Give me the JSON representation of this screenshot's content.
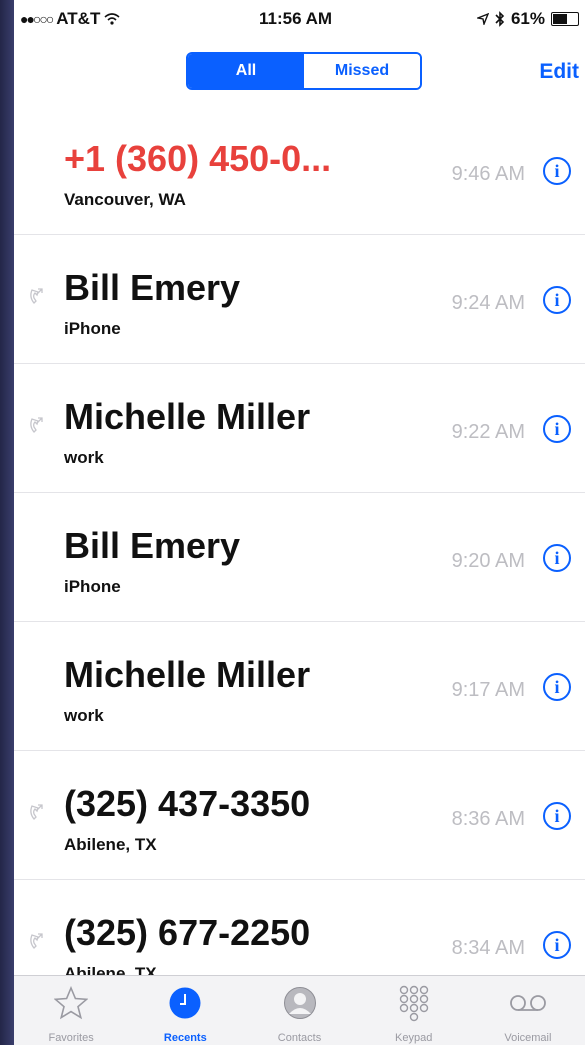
{
  "status_bar": {
    "signal": "●●○○○",
    "carrier": "AT&T",
    "time": "11:56 AM",
    "battery": "61%",
    "battery_level": 0.61
  },
  "nav": {
    "segments": [
      "All",
      "Missed"
    ],
    "selected_segment": "All",
    "edit_label": "Edit"
  },
  "calls": [
    {
      "name": "+1 (360) 450-0...",
      "detail": "Vancouver, WA",
      "time": "9:46 AM",
      "missed": true,
      "outgoing": false
    },
    {
      "name": "Bill Emery",
      "detail": "iPhone",
      "time": "9:24 AM",
      "missed": false,
      "outgoing": true
    },
    {
      "name": "Michelle Miller",
      "detail": "work",
      "time": "9:22 AM",
      "missed": false,
      "outgoing": true
    },
    {
      "name": "Bill Emery",
      "detail": "iPhone",
      "time": "9:20 AM",
      "missed": false,
      "outgoing": false
    },
    {
      "name": "Michelle Miller",
      "detail": "work",
      "time": "9:17 AM",
      "missed": false,
      "outgoing": false
    },
    {
      "name": "(325) 437-3350",
      "detail": "Abilene, TX",
      "time": "8:36 AM",
      "missed": false,
      "outgoing": true
    },
    {
      "name": "(325) 677-2250",
      "detail": "Abilene, TX",
      "time": "8:34 AM",
      "missed": false,
      "outgoing": true
    }
  ],
  "tabs": [
    {
      "label": "Favorites",
      "icon": "star-icon",
      "active": false
    },
    {
      "label": "Recents",
      "icon": "clock-icon",
      "active": true
    },
    {
      "label": "Contacts",
      "icon": "person-circle-icon",
      "active": false
    },
    {
      "label": "Keypad",
      "icon": "keypad-icon",
      "active": false
    },
    {
      "label": "Voicemail",
      "icon": "voicemail-icon",
      "active": false
    }
  ],
  "colors": {
    "accent": "#0a60ff",
    "missed": "#e8413c",
    "time_text": "#bdbdc2"
  }
}
